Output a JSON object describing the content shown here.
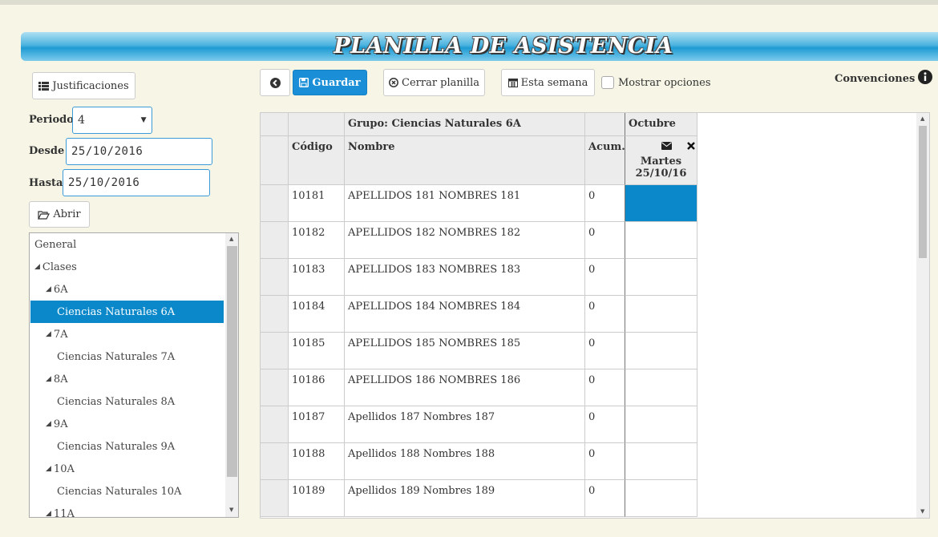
{
  "title": "PLANILLA DE ASISTENCIA",
  "sidebar": {
    "justificaciones_label": "Justificaciones",
    "periodo_label": "Periodo",
    "periodo_value": "4",
    "desde_label": "Desde",
    "desde_value": "25/10/2016",
    "hasta_label": "Hasta",
    "hasta_value": "25/10/2016",
    "abrir_label": "Abrir",
    "tree": [
      {
        "label": "General",
        "indent": 0,
        "toggle": false,
        "selected": false
      },
      {
        "label": "Clases",
        "indent": 1,
        "toggle": true,
        "selected": false
      },
      {
        "label": "6A",
        "indent": 2,
        "toggle": true,
        "selected": false
      },
      {
        "label": "Ciencias Naturales 6A",
        "indent": 3,
        "toggle": false,
        "selected": true
      },
      {
        "label": "7A",
        "indent": 2,
        "toggle": true,
        "selected": false
      },
      {
        "label": "Ciencias Naturales 7A",
        "indent": 3,
        "toggle": false,
        "selected": false
      },
      {
        "label": "8A",
        "indent": 2,
        "toggle": true,
        "selected": false
      },
      {
        "label": "Ciencias Naturales 8A",
        "indent": 3,
        "toggle": false,
        "selected": false
      },
      {
        "label": "9A",
        "indent": 2,
        "toggle": true,
        "selected": false
      },
      {
        "label": "Ciencias Naturales 9A",
        "indent": 3,
        "toggle": false,
        "selected": false
      },
      {
        "label": "10A",
        "indent": 2,
        "toggle": true,
        "selected": false
      },
      {
        "label": "Ciencias Naturales 10A",
        "indent": 3,
        "toggle": false,
        "selected": false
      },
      {
        "label": "11A",
        "indent": 2,
        "toggle": true,
        "selected": false
      }
    ]
  },
  "toolbar": {
    "back_icon": "circle-arrow-left-icon",
    "guardar_label": "Guardar",
    "cerrar_label": "Cerrar planilla",
    "semana_label": "Esta semana",
    "mostrar_label": "Mostrar opciones",
    "convenciones_label": "Convenciones"
  },
  "grid": {
    "group_label": "Grupo: Ciencias Naturales 6A",
    "month_label": "Octubre",
    "col_codigo": "Código",
    "col_nombre": "Nombre",
    "col_acum": "Acum.",
    "day_name": "Martes",
    "day_date": "25/10/16",
    "selected_color": "#0a88c9",
    "rows": [
      {
        "codigo": "10181",
        "nombre": "APELLIDOS 181 NOMBRES 181",
        "acum": "0"
      },
      {
        "codigo": "10182",
        "nombre": "APELLIDOS 182 NOMBRES 182",
        "acum": "0"
      },
      {
        "codigo": "10183",
        "nombre": "APELLIDOS 183 NOMBRES 183",
        "acum": "0"
      },
      {
        "codigo": "10184",
        "nombre": "APELLIDOS 184 NOMBRES 184",
        "acum": "0"
      },
      {
        "codigo": "10185",
        "nombre": "APELLIDOS 185 NOMBRES 185",
        "acum": "0"
      },
      {
        "codigo": "10186",
        "nombre": "APELLIDOS 186 NOMBRES 186",
        "acum": "0"
      },
      {
        "codigo": "10187",
        "nombre": "Apellidos 187 Nombres 187",
        "acum": "0"
      },
      {
        "codigo": "10188",
        "nombre": "Apellidos 188 Nombres 188",
        "acum": "0"
      },
      {
        "codigo": "10189",
        "nombre": "Apellidos 189 Nombres 189",
        "acum": "0"
      }
    ]
  }
}
